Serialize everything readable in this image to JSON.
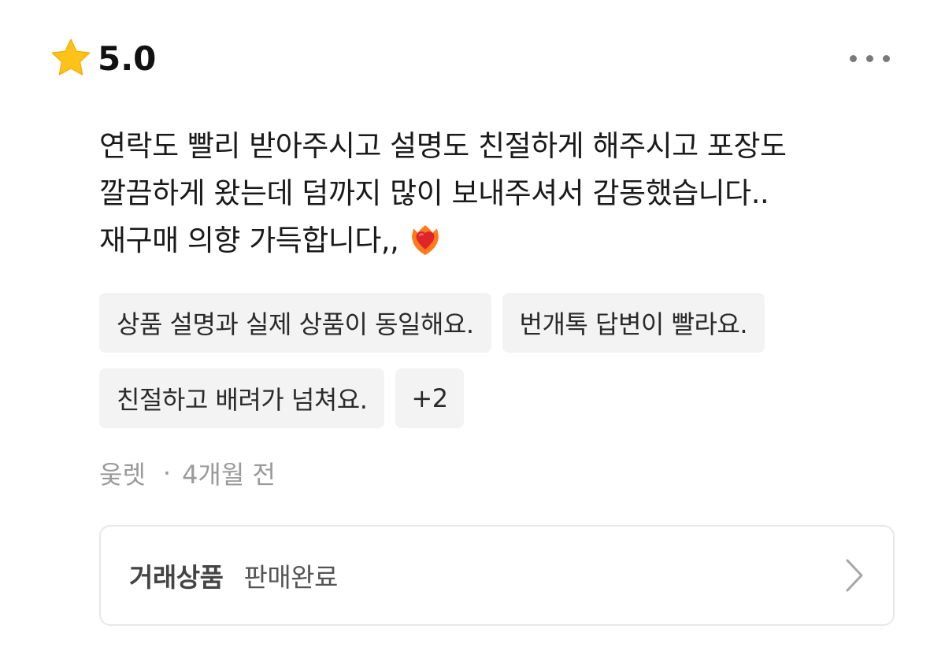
{
  "rating": {
    "value": "5.0",
    "icon": "star-icon",
    "star_color": "#FFC21A"
  },
  "menu": {
    "icon": "more-horizontal-icon"
  },
  "review": {
    "lines": [
      "연락도 빨리 받아주시고 설명도 친절하게 해주시고 포장도",
      "깔끔하게 왔는데 덤까지 많이 보내주셔서 감동했습니다..",
      "재구매 의향 가득합니다,,"
    ],
    "emoji_icon": "heart-on-fire-icon"
  },
  "tags": [
    "상품 설명과 실제 상품이 동일해요.",
    "번개톡 답변이 빨라요.",
    "친절하고 배려가 넘쳐요."
  ],
  "tags_more": "+2",
  "meta": {
    "author": "웆렛",
    "separator": "·",
    "time": "4개월 전"
  },
  "product": {
    "label": "거래상품",
    "status": "판매완료",
    "icon": "chevron-right-icon"
  }
}
